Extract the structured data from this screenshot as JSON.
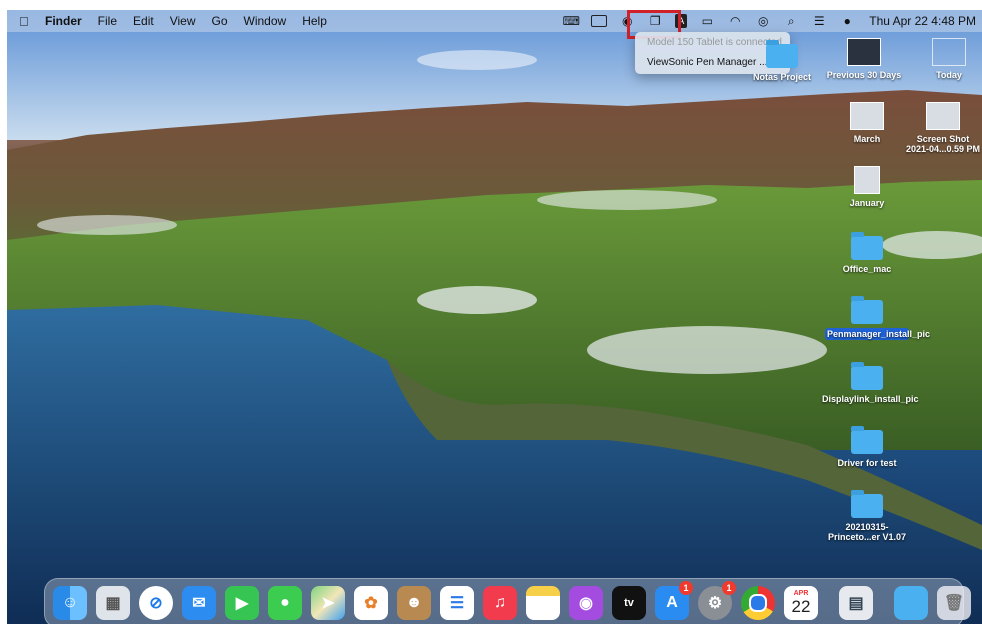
{
  "menubar": {
    "apple": "",
    "items": [
      "Finder",
      "File",
      "Edit",
      "View",
      "Go",
      "Window",
      "Help"
    ],
    "clock": "Thu Apr 22  4:48 PM"
  },
  "status_icons": [
    "keyboard-icon",
    "pen-tablet-icon",
    "record-icon",
    "screen-mirror-icon",
    "input-source-icon",
    "battery-icon",
    "wifi-icon",
    "user-icon",
    "spotlight-icon",
    "control-center-icon",
    "siri-icon"
  ],
  "dropdown": {
    "status": "Model 150 Tablet is connected",
    "manager": "ViewSonic Pen Manager ..."
  },
  "desktop": {
    "icons": [
      {
        "label": "Notas Project"
      },
      {
        "label": "Previous 30 Days"
      },
      {
        "label": "Today"
      },
      {
        "label": "March"
      },
      {
        "label": "Screen Shot 2021-04...0.59 PM"
      },
      {
        "label": "January"
      },
      {
        "label": "Office_mac"
      },
      {
        "label": "Penmanager_install_pic"
      },
      {
        "label": "Displaylink_install_pic"
      },
      {
        "label": "Driver for test"
      },
      {
        "label": "20210315-Princeto...er V1.07"
      }
    ]
  },
  "dock": {
    "apps": [
      "Finder",
      "Launchpad",
      "Safari",
      "Mail",
      "FaceTime",
      "Messages",
      "Maps",
      "Photos",
      "Contacts",
      "Reminders",
      "Music",
      "Notes",
      "Podcasts",
      "TV",
      "App Store",
      "System Preferences",
      "Chrome",
      "Calendar",
      "Preview",
      "Downloads",
      "Trash"
    ],
    "badges": {
      "app_store": "1",
      "system_preferences": "1"
    },
    "tv_label": "tv",
    "calendar": {
      "month": "APR",
      "day": "22"
    }
  }
}
